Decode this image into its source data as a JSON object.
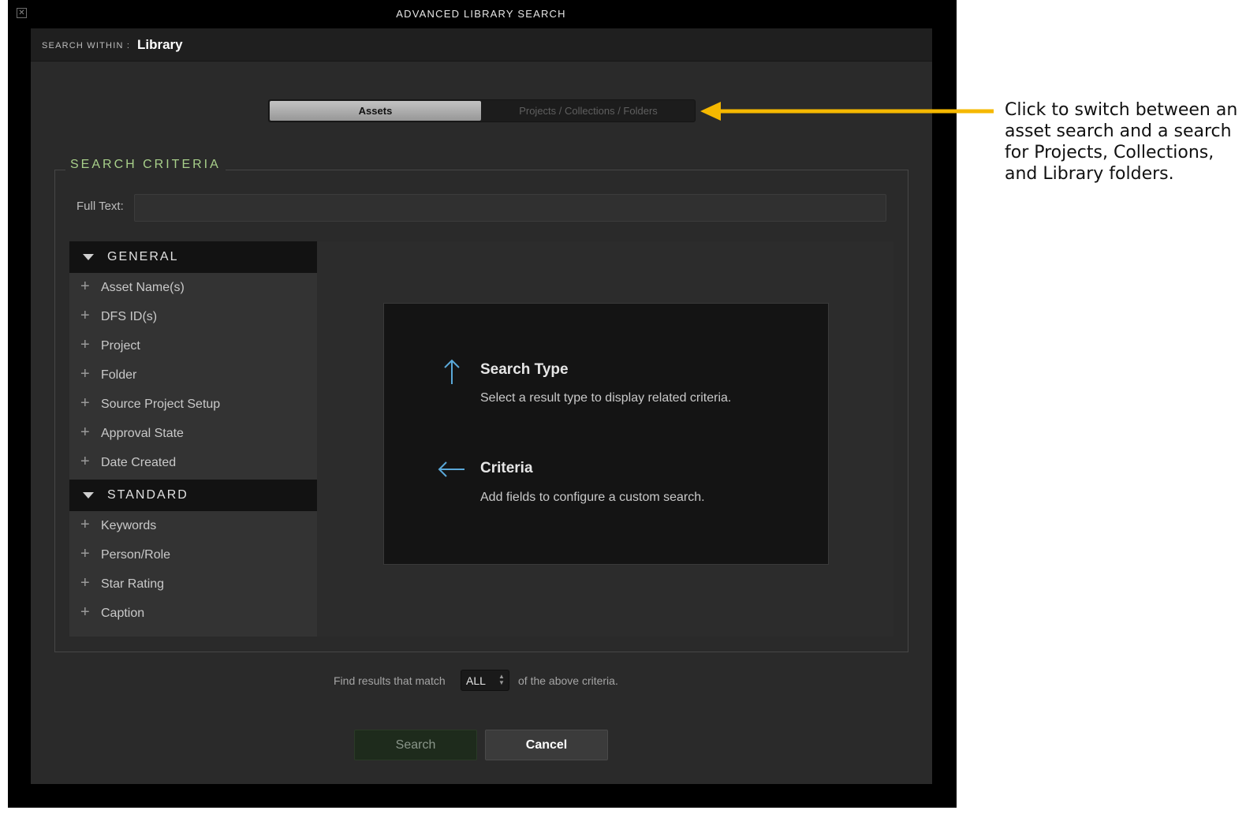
{
  "window": {
    "title": "ADVANCED LIBRARY SEARCH",
    "close_icon": "close-box-icon"
  },
  "dialog": {
    "search_within_label": "SEARCH WITHIN :",
    "search_within_value": "Library"
  },
  "search_type": {
    "selected": "Assets",
    "options": [
      "Assets",
      "Projects / Collections / Folders"
    ]
  },
  "criteria": {
    "legend": "SEARCH CRITERIA",
    "full_text_label": "Full Text:",
    "full_text_value": "",
    "groups": [
      {
        "label": "GENERAL",
        "expanded": true,
        "items": [
          "Asset Name(s)",
          "DFS ID(s)",
          "Project",
          "Folder",
          "Source Project Setup",
          "Approval State",
          "Date Created"
        ]
      },
      {
        "label": "STANDARD",
        "expanded": true,
        "items": [
          "Keywords",
          "Person/Role",
          "Star Rating",
          "Caption"
        ]
      }
    ]
  },
  "info": {
    "search_type_title": "Search Type",
    "search_type_desc": "Select a result type to display related criteria.",
    "criteria_title": "Criteria",
    "criteria_desc": "Add fields to configure a custom search.",
    "icon_color": "#5aa8d8"
  },
  "match": {
    "before": "Find results that match",
    "value": "ALL",
    "after": "of the above criteria."
  },
  "buttons": {
    "search": "Search",
    "cancel": "Cancel"
  },
  "annotation": {
    "text": "Click to switch between an asset search and a search for Projects, Collections, and Library folders.",
    "arrow_color": "#f5b800"
  }
}
